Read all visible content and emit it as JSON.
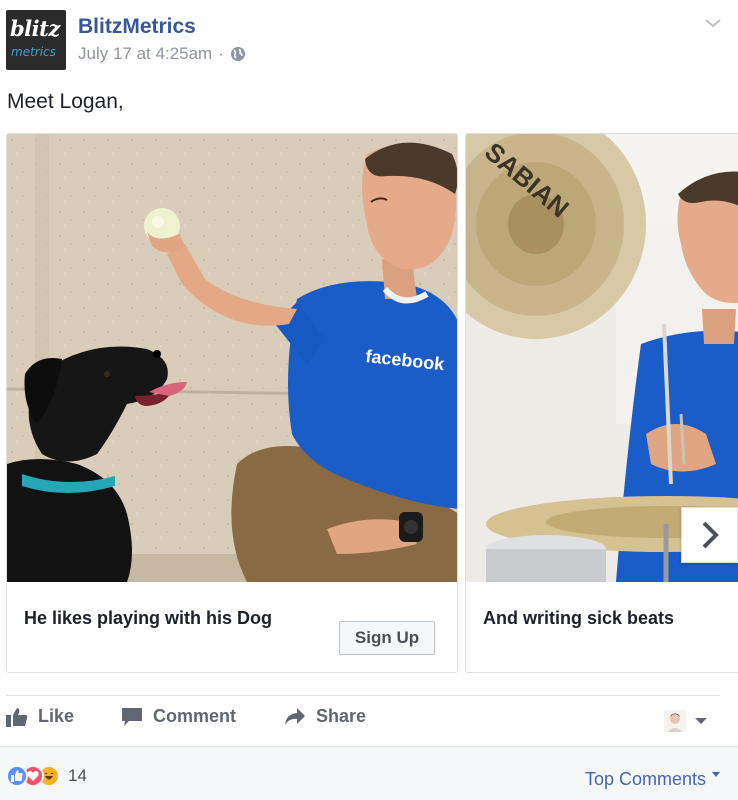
{
  "post": {
    "page_name": "BlitzMetrics",
    "logo_text_top": "blitz",
    "logo_text_bottom": "metrics",
    "timestamp": "July 17 at 4:25am",
    "separator": "·",
    "audience_icon": "globe-icon",
    "menu_icon": "chevron-down-icon",
    "text": "Meet Logan,"
  },
  "carousel": {
    "cards": [
      {
        "caption": "He likes playing with his Dog",
        "cta": "Sign Up",
        "image": "man-with-dog-photo"
      },
      {
        "caption": "And writing sick beats",
        "image": "man-playing-drums-photo"
      }
    ],
    "shirt_text": "facebook",
    "cymbal_text": "SABIAN",
    "next_icon": "chevron-right-icon"
  },
  "actions": {
    "like": "Like",
    "comment": "Comment",
    "share": "Share"
  },
  "footer": {
    "reaction_icons": [
      "like-reaction-icon",
      "love-reaction-icon",
      "haha-reaction-icon"
    ],
    "reaction_count": "14",
    "top_comments": "Top Comments"
  },
  "colors": {
    "link": "#365899",
    "accent": "#4267b2",
    "muted": "#90949c",
    "shirt": "#1a5cc8"
  }
}
